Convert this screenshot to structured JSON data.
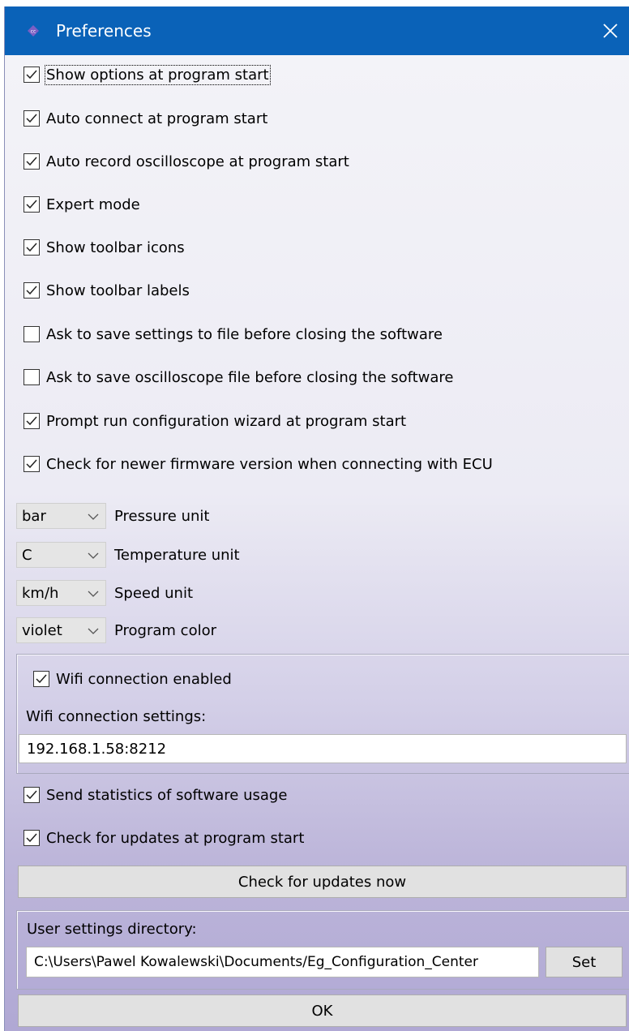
{
  "window": {
    "title": "Preferences",
    "app_icon": "app-logo-icon",
    "close_icon": "close-icon"
  },
  "options": [
    {
      "label": "Show options at program start",
      "checked": true
    },
    {
      "label": "Auto connect at program start",
      "checked": true
    },
    {
      "label": "Auto record oscilloscope at program start",
      "checked": true
    },
    {
      "label": "Expert mode",
      "checked": true
    },
    {
      "label": "Show toolbar icons",
      "checked": true
    },
    {
      "label": "Show toolbar labels",
      "checked": true
    },
    {
      "label": "Ask to save settings to file before closing the software",
      "checked": false
    },
    {
      "label": "Ask to save oscilloscope file before closing the software",
      "checked": false
    },
    {
      "label": "Prompt run configuration wizard at program start",
      "checked": true
    },
    {
      "label": "Check for newer firmware version when connecting with ECU",
      "checked": true
    }
  ],
  "units": [
    {
      "value": "bar",
      "label": "Pressure unit"
    },
    {
      "value": "C",
      "label": "Temperature unit"
    },
    {
      "value": "km/h",
      "label": "Speed unit"
    },
    {
      "value": "violet",
      "label": "Program color"
    }
  ],
  "wifi": {
    "enabled_label": "Wifi connection enabled",
    "enabled": true,
    "settings_label": "Wifi connection settings:",
    "address": "192.168.1.58:8212"
  },
  "statistics": {
    "label": "Send statistics of software usage",
    "checked": true
  },
  "updates": {
    "check_label": "Check for updates at program start",
    "checked": true,
    "button_label": "Check for updates now"
  },
  "user_settings": {
    "label": "User settings directory:",
    "path": "C:\\Users\\Pawel Kowalewski\\Documents/Eg_Configuration_Center",
    "set_label": "Set"
  },
  "ok_label": "OK",
  "colors": {
    "titlebar": "#0a62b8",
    "accent": "#7b5fc4"
  }
}
